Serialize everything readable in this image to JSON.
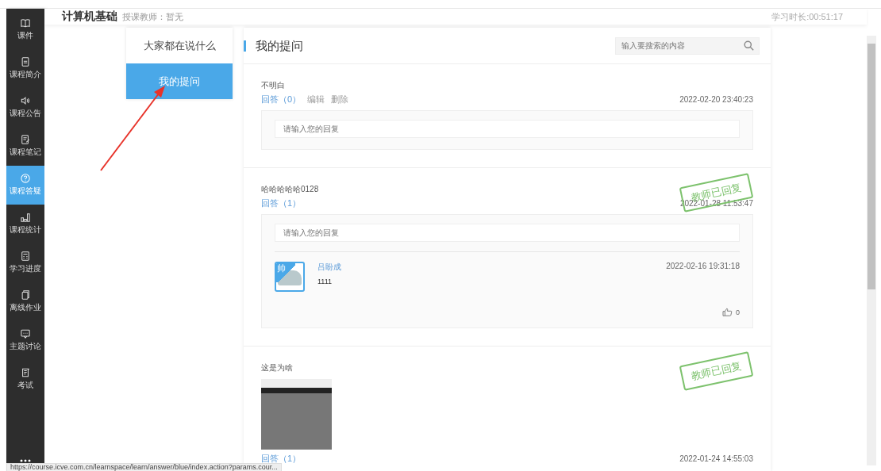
{
  "header": {
    "course_title": "计算机基础",
    "teacher": "授课教师：暂无",
    "study_time": "学习时长:00:51:17"
  },
  "sidebar": {
    "items": [
      {
        "kind": "book",
        "label": "课件",
        "selected": false
      },
      {
        "kind": "document",
        "label": "课程简介",
        "selected": false
      },
      {
        "kind": "speaker",
        "label": "课程公告",
        "selected": false
      },
      {
        "kind": "note",
        "label": "课程笔记",
        "selected": false
      },
      {
        "kind": "question",
        "label": "课程答疑",
        "selected": true
      },
      {
        "kind": "chart",
        "label": "课程统计",
        "selected": false
      },
      {
        "kind": "calculator",
        "label": "学习进度",
        "selected": false
      },
      {
        "kind": "pages",
        "label": "离线作业",
        "selected": false
      },
      {
        "kind": "chat",
        "label": "主题讨论",
        "selected": false
      },
      {
        "kind": "exam",
        "label": "考试",
        "selected": false
      }
    ]
  },
  "tabs": [
    {
      "label": "大家都在说什么",
      "selected": false
    },
    {
      "label": "我的提问",
      "selected": true
    }
  ],
  "panel": {
    "title": "我的提问",
    "search": {
      "placeholder": "输入要搜索的内容"
    }
  },
  "questions": [
    {
      "title": "不明白",
      "actions": [
        "回答（0）",
        "编辑",
        "删除"
      ],
      "time": "2022-02-20 23:40:23",
      "teacher_replied": false,
      "reply_placeholder": "请输入您的回复"
    },
    {
      "title": "哈哈哈哈哈0128",
      "actions": [
        "回答（1）"
      ],
      "time": "2022-01-28 11:53:47",
      "teacher_replied": true,
      "stamp": "教师已回复",
      "reply_placeholder": "请输入您的回复",
      "replies": [
        {
          "avatar_badge": "帅",
          "name": "吕盼成",
          "text": "1111",
          "time": "2022-02-16 19:31:18",
          "likes": "0"
        }
      ]
    },
    {
      "title": "这是为啥",
      "has_image": true,
      "actions": [
        "回答（1）"
      ],
      "time": "2022-01-24 14:55:03",
      "teacher_replied": true,
      "stamp": "教师已回复"
    }
  ],
  "status_bar": {
    "url": "https://course.icve.com.cn/learnspace/learn/answer/blue/index.action?params.cour..."
  }
}
